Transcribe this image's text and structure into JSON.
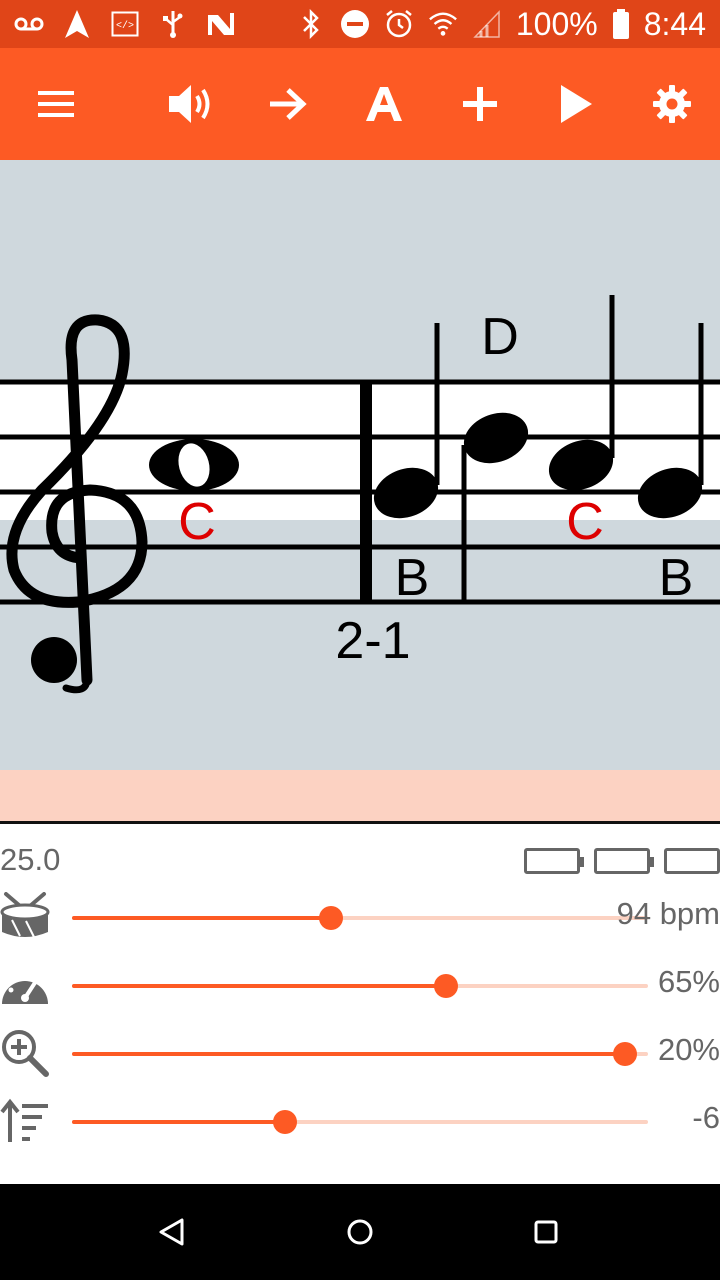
{
  "status_bar": {
    "battery": "100%",
    "time": "8:44",
    "left_icons": [
      "voicemail-icon",
      "navigation-icon",
      "code-icon",
      "usb-icon",
      "app-n-icon"
    ],
    "right_icons": [
      "bluetooth-icon",
      "dnd-icon",
      "alarm-icon",
      "wifi-icon",
      "signal-icon",
      "battery-icon"
    ]
  },
  "toolbar": {
    "buttons": [
      "menu-icon",
      "volume-icon",
      "arrow-right-icon",
      "text-a-icon",
      "plus-icon",
      "play-icon",
      "gear-icon"
    ]
  },
  "score": {
    "note_labels": [
      "C",
      "B",
      "D",
      "C",
      "B"
    ],
    "measure_label": "2-1",
    "colors": {
      "highlight": "#dd0000",
      "staff_bg": "#cfd8dd",
      "staff_white": "#ffffff"
    }
  },
  "panel": {
    "position_value": "25.0",
    "sliders": [
      {
        "icon": "drum-icon",
        "value_text": "94 bpm",
        "fraction": 0.45
      },
      {
        "icon": "speedometer-icon",
        "value_text": "65%",
        "fraction": 0.65
      },
      {
        "icon": "zoom-in-icon",
        "value_text": "20%",
        "fraction": 0.96
      },
      {
        "icon": "pitch-shift-icon",
        "value_text": "-6",
        "fraction": 0.37
      }
    ]
  },
  "nav_bar": {
    "buttons": [
      "back-icon",
      "home-icon",
      "recents-icon"
    ]
  },
  "colors": {
    "accent": "#fd5a24",
    "status_bar": "#e04518",
    "track": "#fcd2c2"
  }
}
